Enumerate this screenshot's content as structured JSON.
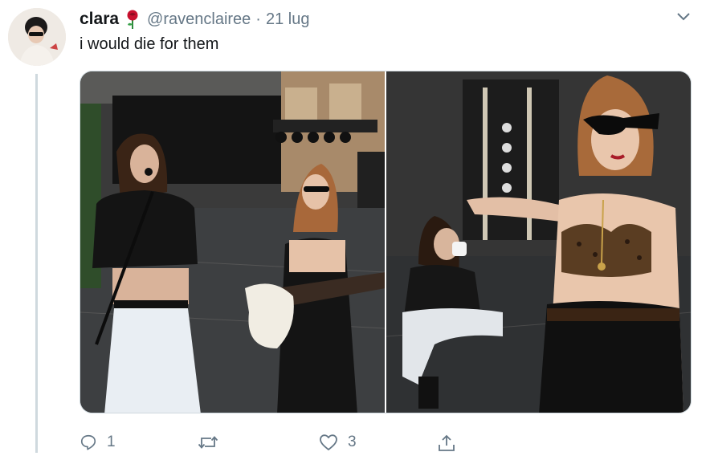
{
  "tweet": {
    "author_name": "clara",
    "handle": "@ravenclairee",
    "separator": "·",
    "date": "21 lug",
    "text": "i would die for them"
  },
  "media": {
    "count": 2
  },
  "actions": {
    "reply_count": "1",
    "retweet_count": "",
    "like_count": "3"
  },
  "colors": {
    "text_primary": "#14171a",
    "text_secondary": "#657786",
    "thread_line": "#cfd9de",
    "rose": "#c8102e"
  },
  "icons": {
    "rose": "rose-emoji-icon",
    "caret": "chevron-down-icon",
    "reply": "reply-icon",
    "retweet": "retweet-icon",
    "like": "heart-icon",
    "share": "share-icon"
  }
}
